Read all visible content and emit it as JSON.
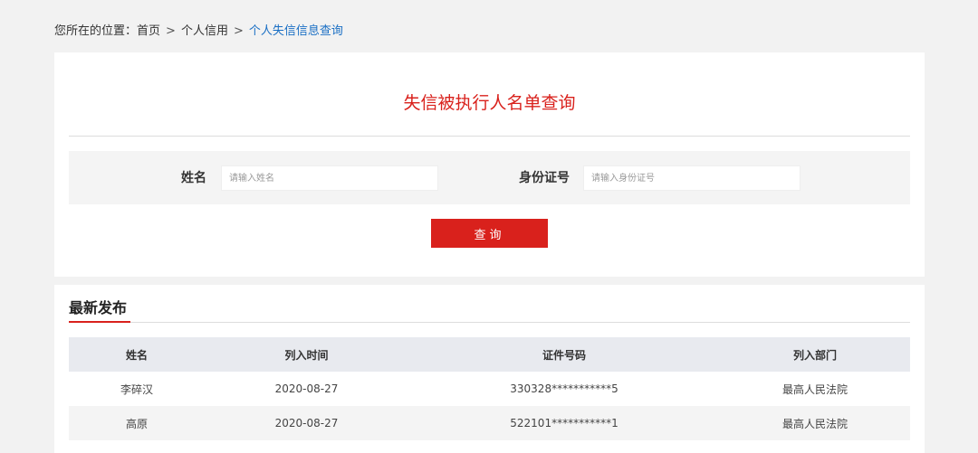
{
  "breadcrumb": {
    "prefix": "您所在的位置：",
    "items": [
      "首页",
      "个人信用",
      "个人失信信息查询"
    ],
    "separator": ">"
  },
  "query": {
    "title": "失信被执行人名单查询",
    "name_label": "姓名",
    "name_placeholder": "请输入姓名",
    "name_value": "",
    "id_label": "身份证号",
    "id_placeholder": "请输入身份证号",
    "id_value": "",
    "button_label": "查询"
  },
  "latest": {
    "title": "最新发布",
    "columns": [
      "姓名",
      "列入时间",
      "证件号码",
      "列入部门"
    ],
    "rows": [
      [
        "李碎汉",
        "2020-08-27",
        "330328***********5",
        "最高人民法院"
      ],
      [
        "高原",
        "2020-08-27",
        "522101***********1",
        "最高人民法院"
      ]
    ]
  },
  "colors": {
    "accent": "#d9211c",
    "link": "#1a6fc4",
    "page_background": "#f2f2f2",
    "table_header": "#e8eaef"
  }
}
